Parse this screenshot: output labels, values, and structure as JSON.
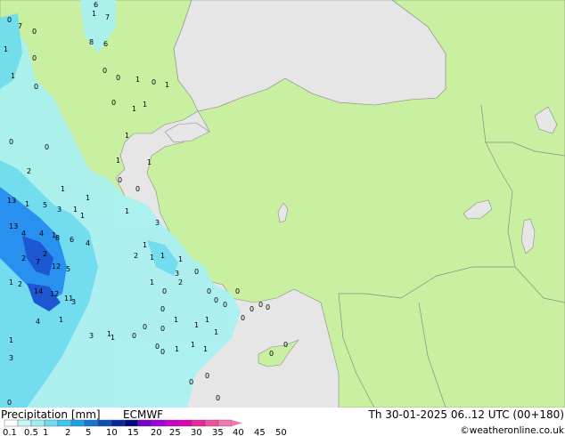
{
  "product": {
    "title": "Precipitation [mm]",
    "model": "ECMWF"
  },
  "valid_time": "Th 30-01-2025 06..12 UTC (00+180)",
  "credit": "©weatheronline.co.uk",
  "legend": {
    "colors": [
      "#ffffff",
      "#c8f5f5",
      "#a0ecf0",
      "#6edcf0",
      "#3cc8f0",
      "#1ea0e6",
      "#1478d2",
      "#0a50b4",
      "#08289a",
      "#000a78",
      "#7800c8",
      "#a000dc",
      "#c800c8",
      "#dc00b4",
      "#e6289b",
      "#f050a0",
      "#f078b4"
    ],
    "tick_labels": [
      "0.1",
      "0.5",
      "1",
      "2",
      "5",
      "10",
      "15",
      "20",
      "25",
      "30",
      "35",
      "40",
      "45",
      "50"
    ]
  },
  "colors": {
    "sea": "#e6e6e6",
    "land_rain_free": "#c8f0a0",
    "light_rain": "#aaf0f0",
    "moderate_rain": "#6edcf0",
    "heavy_rain": "#1e8cf0",
    "very_heavy_rain": "#1450d2",
    "border": "#8a8a8a"
  },
  "rain_amounts": [
    "7",
    "1",
    "7",
    "6",
    "8",
    "0",
    "1",
    "1",
    "0",
    "6",
    "0",
    "0",
    "0",
    "0",
    "1",
    "0",
    "1",
    "1",
    "0",
    "1",
    "1",
    "1",
    "0",
    "1",
    "0",
    "2",
    "1",
    "0",
    "1",
    "0",
    "1",
    "13",
    "1",
    "5",
    "3",
    "1",
    "1",
    "3",
    "13",
    "4",
    "4",
    "1",
    "8",
    "6",
    "4",
    "1",
    "2",
    "7",
    "2",
    "12",
    "5",
    "2",
    "1",
    "1",
    "1",
    "2",
    "1",
    "2",
    "1",
    "3",
    "14",
    "12",
    "11",
    "3",
    "4",
    "1",
    "0",
    "0",
    "0",
    "1",
    "1",
    "1",
    "1",
    "0",
    "0",
    "1",
    "3",
    "1",
    "0",
    "1",
    "1",
    "0",
    "1",
    "0",
    "0",
    "1",
    "3",
    "0",
    "0",
    "0",
    "0",
    "0",
    "0",
    "0",
    "0",
    "0",
    "0",
    "0",
    "0",
    "0"
  ]
}
